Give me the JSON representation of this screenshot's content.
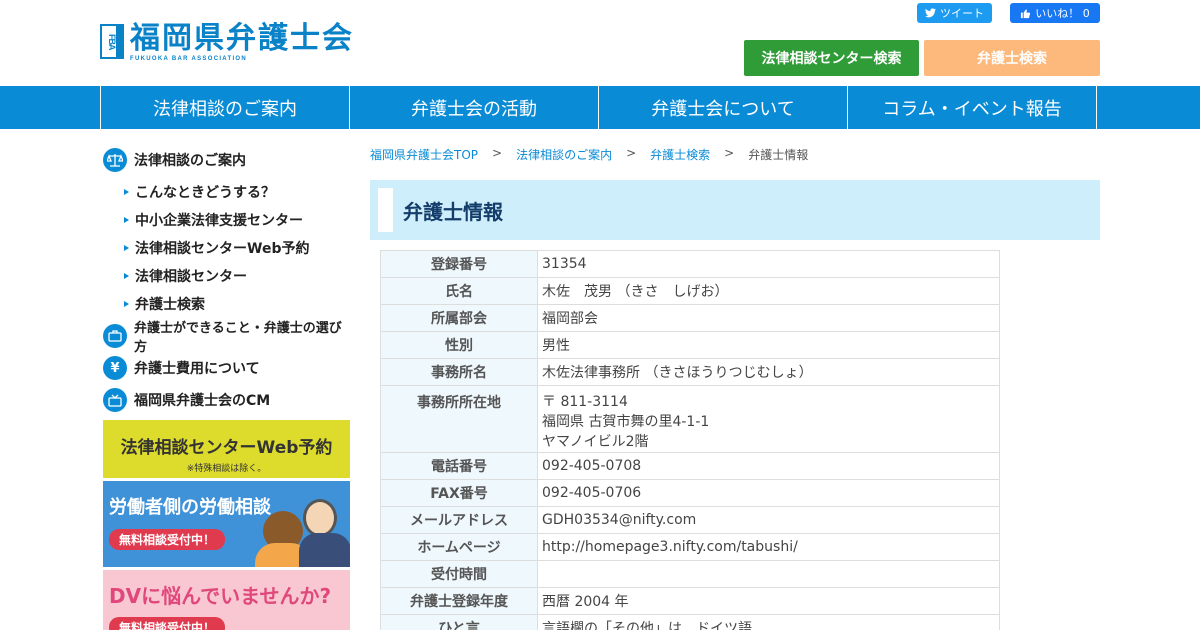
{
  "header": {
    "logo_mark": "FBA",
    "logo_jp": "福岡県弁護士会",
    "logo_en": "FUKUOKA BAR ASSOCIATION",
    "tweet_label": "ツイート",
    "like_label": "いいね！ 0",
    "btn_center_label": "法律相談センター検索",
    "btn_lawyer_label": "弁護士検索"
  },
  "nav": {
    "items": [
      "法律相談のご案内",
      "弁護士会の活動",
      "弁護士会について",
      "コラム・イベント報告"
    ]
  },
  "sidebar": {
    "main1": "法律相談のご案内",
    "subs": [
      "こんなときどうする？",
      "中小企業法律支援センター",
      "法律相談センターWeb予約",
      "法律相談センター",
      "弁護士検索"
    ],
    "main2": "弁護士ができること・弁護士の選び方",
    "main3": "弁護士費用について",
    "main3_icon": "¥",
    "main4": "福岡県弁護士会のCM",
    "banner_web_title": "法律相談センターWeb予約",
    "banner_web_note": "※特殊相談は除く。",
    "banner_labor_title": "労働者側の労働相談",
    "banner_labor_pill": "無料相談受付中！",
    "banner_dv_title": "DVに悩んでいませんか?",
    "banner_dv_pill": "無料相談受付中！"
  },
  "breadcrumb": {
    "items": [
      "福岡県弁護士会TOP",
      "法律相談のご案内",
      "弁護士検索"
    ],
    "current": "弁護士情報",
    "separator": ">"
  },
  "page": {
    "title": "弁護士情報"
  },
  "lawyer": {
    "rows": [
      {
        "k": "登録番号",
        "v": "31354"
      },
      {
        "k": "氏名",
        "v": "木佐　茂男 （きさ　しげお）"
      },
      {
        "k": "所属部会",
        "v": "福岡部会"
      },
      {
        "k": "性別",
        "v": "男性"
      },
      {
        "k": "事務所名",
        "v": "木佐法律事務所 （きさほうりつじむしょ）"
      }
    ],
    "address_label": "事務所所在地",
    "address_lines": [
      "〒 811-3114",
      "福岡県 古賀市舞の里4-1-1",
      "ヤマノイビル2階"
    ],
    "rows2": [
      {
        "k": "電話番号",
        "v": "092-405-0708"
      },
      {
        "k": "FAX番号",
        "v": "092-405-0706"
      },
      {
        "k": "メールアドレス",
        "v": "GDH03534@nifty.com"
      },
      {
        "k": "ホームページ",
        "v": "http://homepage3.nifty.com/tabushi/"
      },
      {
        "k": "受付時間",
        "v": ""
      },
      {
        "k": "弁護士登録年度",
        "v": "西暦 2004 年"
      },
      {
        "k": "ひと言",
        "v": "言語欄の「その他」は、ドイツ語"
      }
    ]
  },
  "colors": {
    "brand_blue": "#0a8bd6",
    "green_button": "#2f9c37",
    "orange_button": "#fdb97c",
    "title_bg": "#cdeefa"
  }
}
